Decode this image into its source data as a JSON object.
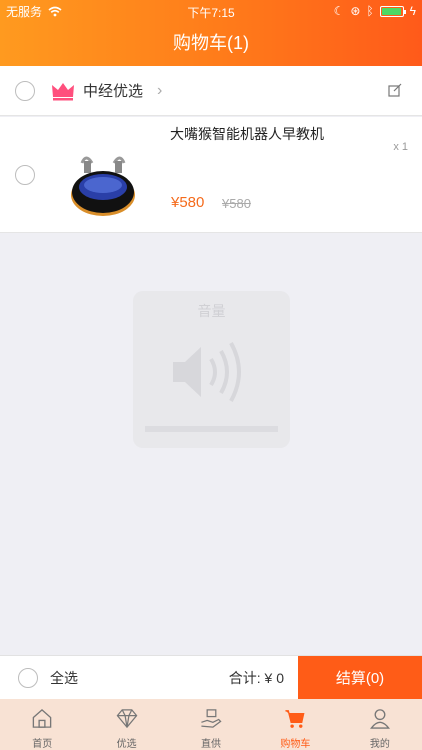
{
  "status_bar": {
    "carrier": "无服务",
    "time": "下午7:15",
    "battery_level": 0.95,
    "battery_color": "#4cd964"
  },
  "nav": {
    "title": "购物车(1)"
  },
  "shop": {
    "name": "中经优选"
  },
  "item": {
    "title": "大嘴猴智能机器人早教机",
    "quantity": "x 1",
    "price": "¥580",
    "original_price": "¥580"
  },
  "volume_hud": {
    "label": "音量",
    "level": 0
  },
  "bottom_bar": {
    "select_all": "全选",
    "total": "合计: ¥ 0",
    "checkout": "结算(0)"
  },
  "tabs": [
    {
      "label": "首页",
      "icon": "home-icon"
    },
    {
      "label": "优选",
      "icon": "diamond-icon"
    },
    {
      "label": "直供",
      "icon": "hand-gift-icon"
    },
    {
      "label": "购物车",
      "icon": "cart-icon",
      "active": true
    },
    {
      "label": "我的",
      "icon": "user-icon"
    }
  ],
  "colors": {
    "accent": "#ff5c17",
    "price": "#f56b1c",
    "header_start": "#ff9a1f",
    "header_end": "#ff5a1a"
  }
}
